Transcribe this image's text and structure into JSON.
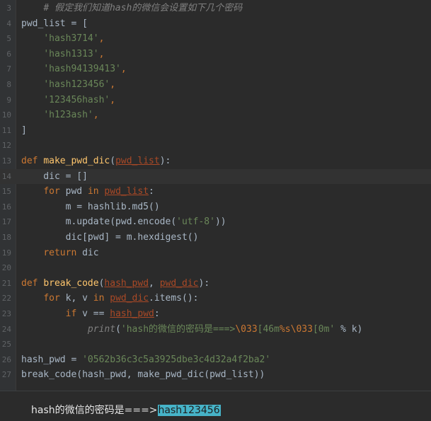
{
  "editor": {
    "lines": [
      {
        "num": "3",
        "tokens": [
          {
            "t": "    ",
            "c": "op"
          },
          {
            "t": "# 假定我们知道hash的微信会设置如下几个密码",
            "c": "comment"
          }
        ]
      },
      {
        "num": "4",
        "tokens": [
          {
            "t": "pwd_list",
            "c": "op"
          },
          {
            "t": " = [",
            "c": "op"
          }
        ]
      },
      {
        "num": "5",
        "tokens": [
          {
            "t": "    ",
            "c": "op"
          },
          {
            "t": "'hash3714'",
            "c": "string"
          },
          {
            "t": ",",
            "c": "keyword"
          }
        ]
      },
      {
        "num": "6",
        "tokens": [
          {
            "t": "    ",
            "c": "op"
          },
          {
            "t": "'hash1313'",
            "c": "string"
          },
          {
            "t": ",",
            "c": "keyword"
          }
        ]
      },
      {
        "num": "7",
        "tokens": [
          {
            "t": "    ",
            "c": "op"
          },
          {
            "t": "'hash94139413'",
            "c": "string"
          },
          {
            "t": ",",
            "c": "keyword"
          }
        ]
      },
      {
        "num": "8",
        "tokens": [
          {
            "t": "    ",
            "c": "op"
          },
          {
            "t": "'hash123456'",
            "c": "string"
          },
          {
            "t": ",",
            "c": "keyword"
          }
        ]
      },
      {
        "num": "9",
        "tokens": [
          {
            "t": "    ",
            "c": "op"
          },
          {
            "t": "'123456hash'",
            "c": "string"
          },
          {
            "t": ",",
            "c": "keyword"
          }
        ]
      },
      {
        "num": "10",
        "tokens": [
          {
            "t": "    ",
            "c": "op"
          },
          {
            "t": "'h123ash'",
            "c": "string"
          },
          {
            "t": ",",
            "c": "keyword"
          }
        ]
      },
      {
        "num": "11",
        "tokens": [
          {
            "t": "]",
            "c": "op"
          }
        ]
      },
      {
        "num": "12",
        "tokens": []
      },
      {
        "num": "13",
        "tokens": [
          {
            "t": "def ",
            "c": "keyword"
          },
          {
            "t": "make_pwd_dic",
            "c": "func"
          },
          {
            "t": "(",
            "c": "op"
          },
          {
            "t": "pwd_list",
            "c": "param"
          },
          {
            "t": "):",
            "c": "op"
          }
        ]
      },
      {
        "num": "14",
        "current": true,
        "tokens": [
          {
            "t": "    dic = ",
            "c": "op"
          },
          {
            "t": "[]",
            "c": "op"
          }
        ]
      },
      {
        "num": "15",
        "tokens": [
          {
            "t": "    ",
            "c": "op"
          },
          {
            "t": "for ",
            "c": "keyword"
          },
          {
            "t": "pwd ",
            "c": "op"
          },
          {
            "t": "in ",
            "c": "keyword"
          },
          {
            "t": "pwd_list",
            "c": "param"
          },
          {
            "t": ":",
            "c": "op"
          }
        ]
      },
      {
        "num": "16",
        "tokens": [
          {
            "t": "        m = hashlib.md5()",
            "c": "op"
          }
        ]
      },
      {
        "num": "17",
        "tokens": [
          {
            "t": "        m.update(pwd.encode(",
            "c": "op"
          },
          {
            "t": "'utf-8'",
            "c": "string"
          },
          {
            "t": "))",
            "c": "op"
          }
        ]
      },
      {
        "num": "18",
        "tokens": [
          {
            "t": "        dic[pwd] = m.hexdigest()",
            "c": "op"
          }
        ]
      },
      {
        "num": "19",
        "tokens": [
          {
            "t": "    ",
            "c": "op"
          },
          {
            "t": "return ",
            "c": "keyword"
          },
          {
            "t": "dic",
            "c": "op"
          }
        ]
      },
      {
        "num": "20",
        "tokens": []
      },
      {
        "num": "21",
        "tokens": [
          {
            "t": "def ",
            "c": "keyword"
          },
          {
            "t": "break_code",
            "c": "func"
          },
          {
            "t": "(",
            "c": "op"
          },
          {
            "t": "hash_pwd",
            "c": "param"
          },
          {
            "t": ", ",
            "c": "op"
          },
          {
            "t": "pwd_dic",
            "c": "param"
          },
          {
            "t": "):",
            "c": "op"
          }
        ]
      },
      {
        "num": "22",
        "tokens": [
          {
            "t": "    ",
            "c": "op"
          },
          {
            "t": "for ",
            "c": "keyword"
          },
          {
            "t": "k, v ",
            "c": "op"
          },
          {
            "t": "in ",
            "c": "keyword"
          },
          {
            "t": "pwd_dic",
            "c": "param"
          },
          {
            "t": ".items():",
            "c": "op"
          }
        ]
      },
      {
        "num": "23",
        "tokens": [
          {
            "t": "        ",
            "c": "op"
          },
          {
            "t": "if ",
            "c": "keyword"
          },
          {
            "t": "v == ",
            "c": "op"
          },
          {
            "t": "hash_pwd",
            "c": "param"
          },
          {
            "t": ":",
            "c": "op"
          }
        ]
      },
      {
        "num": "24",
        "tokens": [
          {
            "t": "            ",
            "c": "op"
          },
          {
            "t": "print",
            "c": "comment"
          },
          {
            "t": "(",
            "c": "op"
          },
          {
            "t": "'hash的微信的密码是===>",
            "c": "string"
          },
          {
            "t": "\\033",
            "c": "fmt"
          },
          {
            "t": "[46m",
            "c": "string"
          },
          {
            "t": "%s",
            "c": "fmt"
          },
          {
            "t": "\\033",
            "c": "fmt"
          },
          {
            "t": "[0m'",
            "c": "string"
          },
          {
            "t": " % k)",
            "c": "op"
          }
        ]
      },
      {
        "num": "25",
        "tokens": []
      },
      {
        "num": "26",
        "tokens": [
          {
            "t": "hash_pwd = ",
            "c": "op"
          },
          {
            "t": "'0562b36c3c5a3925dbe3c4d32a4f2ba2'",
            "c": "string"
          }
        ]
      },
      {
        "num": "27",
        "tokens": [
          {
            "t": "break_code(hash_pwd, make_pwd_dic(pwd_list))",
            "c": "op"
          }
        ]
      }
    ]
  },
  "console": {
    "prefix": "hash的微信的密码是===>",
    "highlighted": "hash123456",
    "highlight_color": "#46b3c8"
  },
  "colors": {
    "background": "#2b2b2b",
    "comment": "#808080",
    "keyword": "#cc7832",
    "string": "#6a8759",
    "function": "#ffc66d",
    "parameter": "#aa4926"
  }
}
